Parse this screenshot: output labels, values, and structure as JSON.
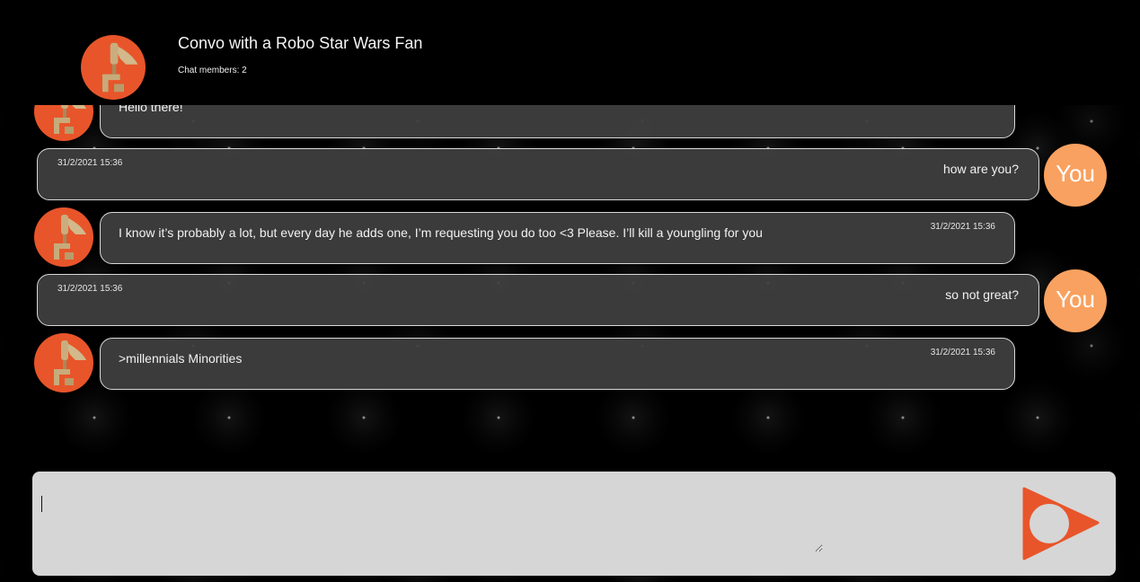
{
  "header": {
    "title": "Convo with a Robo Star Wars Fan",
    "members": "Chat members: 2"
  },
  "you_label": "You",
  "messages": [
    {
      "sender": "bot",
      "text": "Hello there!",
      "time": ""
    },
    {
      "sender": "you",
      "text": "how are you?",
      "time": "31/2/2021 15:36"
    },
    {
      "sender": "bot",
      "text": "I know it’s probably a lot, but every day he adds one, I’m requesting you do too <3 Please. I’ll kill a youngling for you",
      "time": "31/2/2021 15:36"
    },
    {
      "sender": "you",
      "text": "so not great?",
      "time": "31/2/2021 15:36"
    },
    {
      "sender": "bot",
      "text": ">millennials Minorities",
      "time": "31/2/2021 15:36"
    }
  ],
  "composer": {
    "value": "",
    "placeholder": ""
  },
  "colors": {
    "bot_avatar": "#e8552a",
    "you_avatar": "#f9a160",
    "bubble": "#404040",
    "composer": "#d6d6d6",
    "send": "#e8552a"
  },
  "icons": {
    "bot_avatar": "battle-droid-icon",
    "send": "send-arrow-icon"
  }
}
